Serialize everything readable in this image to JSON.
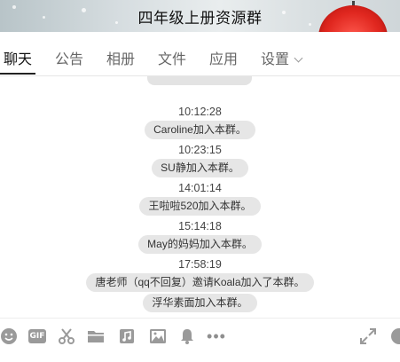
{
  "window": {
    "title": "四年级上册资源群"
  },
  "tabs": [
    {
      "label": "聊天",
      "active": true
    },
    {
      "label": "公告",
      "active": false
    },
    {
      "label": "相册",
      "active": false
    },
    {
      "label": "文件",
      "active": false
    },
    {
      "label": "应用",
      "active": false
    },
    {
      "label": "设置",
      "active": false
    }
  ],
  "chat": {
    "entries": [
      {
        "time": "10:12:28",
        "notice": "Caroline加入本群。"
      },
      {
        "time": "10:23:15",
        "notice": "SU静加入本群。"
      },
      {
        "time": "14:01:14",
        "notice": "王啦啦520加入本群。"
      },
      {
        "time": "15:14:18",
        "notice": "May的妈妈加入本群。"
      },
      {
        "time": "17:58:19",
        "notice": "唐老师（qq不回复）邀请Koala加入了本群。"
      },
      {
        "time": "",
        "notice": "浮华素面加入本群。"
      }
    ]
  },
  "toolbar": {
    "icons": [
      "emoji-icon",
      "gif-icon",
      "scissors-icon",
      "folder-icon",
      "music-icon",
      "image-icon",
      "bell-icon",
      "more-icon",
      "expand-icon",
      "circle-icon"
    ],
    "gif_label": "GIF",
    "more_label": "•••"
  },
  "colors": {
    "notice_bg": "#e6e6e6",
    "icon": "#8f8f8f",
    "accent_umbrella": "#e0271f"
  }
}
